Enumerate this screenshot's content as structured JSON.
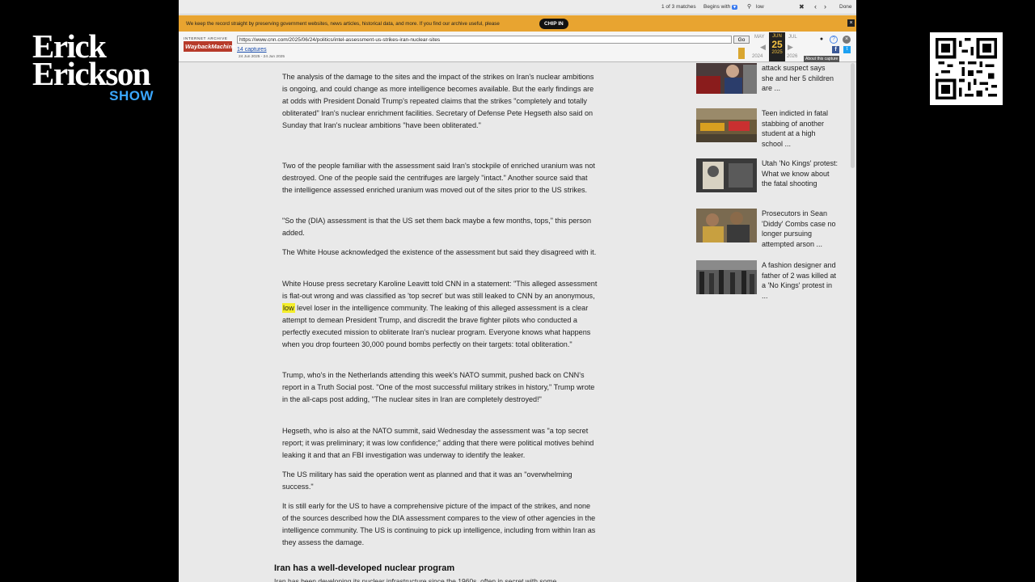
{
  "show": {
    "line1": "Erick",
    "line2": "Erickson",
    "line3": "SHOW"
  },
  "find_bar": {
    "matches": "1 of 3 matches",
    "begins_with": "Begins with",
    "search_term": "low",
    "done": "Done"
  },
  "banner": {
    "message": "We keep the record straight by preserving government websites, news articles, historical data, and more. If you find our archive useful, please",
    "chip_in": "CHIP IN"
  },
  "wayback": {
    "logo_top": "INTERNET ARCHIVE",
    "logo": "WaybackMachine",
    "url": "https://www.cnn.com/2025/06/24/politics/intel-assessment-us-strikes-iran-nuclear-sites",
    "go": "Go",
    "captures": "14 captures",
    "range": "24 Jun 2025 - 24 Jun 2025",
    "prev_month": "MAY",
    "cur_month": "JUN",
    "cur_day": "25",
    "cur_year": "2025",
    "next_month": "JUL",
    "prev_year": "2024",
    "next_year": "2026",
    "about": "About this capture"
  },
  "article": {
    "p1": "The analysis of the damage to the sites and the impact of the strikes on Iran's nuclear ambitions is ongoing, and could change as more intelligence becomes available. But the early findings are at odds with President Donald Trump's repeated claims that the strikes \"completely and totally obliterated\" Iran's nuclear enrichment facilities. Secretary of Defense Pete Hegseth also said on Sunday that Iran's nuclear ambitions \"have been obliterated.\"",
    "p2": "Two of the people familiar with the assessment said Iran's stockpile of enriched uranium was not destroyed. One of the people said the centrifuges are largely \"intact.\" Another source said that the intelligence assessed enriched uranium was moved out of the sites prior to the US strikes.",
    "p3": "\"So the (DIA) assessment is that the US set them back maybe a few months, tops,\" this person added.",
    "p4": "The White House acknowledged the existence of the assessment but said they disagreed with it.",
    "p5_a": "White House press secretary Karoline Leavitt told CNN in a statement: \"This alleged assessment is flat-out wrong and was classified as 'top secret' but was still leaked to CNN by an anonymous, ",
    "p5_hl": "low",
    "p5_b": " level loser in the intelligence community. The leaking of this alleged assessment is a clear attempt to demean President Trump, and discredit the brave fighter pilots who conducted a perfectly executed mission to obliterate Iran's nuclear program. Everyone knows what happens when you drop fourteen 30,000 pound bombs perfectly on their targets: total obliteration.\"",
    "p6": "Trump, who's in the Netherlands attending this week's NATO summit, pushed back on CNN's report in a Truth Social post. \"One of the most successful military strikes in history,\" Trump wrote in the all-caps post adding, \"The nuclear sites in Iran are completely destroyed!\"",
    "p7": "Hegseth, who is also at the NATO summit, said Wednesday the assessment was \"a top secret report; it was preliminary; it was low confidence;\" adding that there were political motives behind leaking it and that an FBI investigation was underway to identify the leaker.",
    "p8": "The US military has said the operation went as planned and that it was an \"overwhelming success.\"",
    "p9": "It is still early for the US to have a comprehensive picture of the impact of the strikes, and none of the sources described how the DIA assessment compares to the view of other agencies in the intelligence community. The US is continuing to pick up intelligence, including from within Iran as they assess the damage.",
    "h2": "Iran has a well-developed nuclear program",
    "p10": "Iran has been developing its nuclear infrastructure since the 1960s, often in secret with some"
  },
  "sidebar": {
    "stories": [
      {
        "headline": "attack suspect says she and her 5 children are ..."
      },
      {
        "headline": "Teen indicted in fatal stabbing of another student at a high school ..."
      },
      {
        "headline": "Utah 'No Kings' protest: What we know about the fatal shooting"
      },
      {
        "headline": "Prosecutors in Sean 'Diddy' Combs case no longer pursuing attempted arson ..."
      },
      {
        "headline": "A fashion designer and father of 2 was killed at a 'No Kings' protest in ..."
      }
    ]
  },
  "colors": {
    "banner": "#e8a430",
    "highlight": "#f4ee2a",
    "show_accent": "#3aa7ff"
  }
}
